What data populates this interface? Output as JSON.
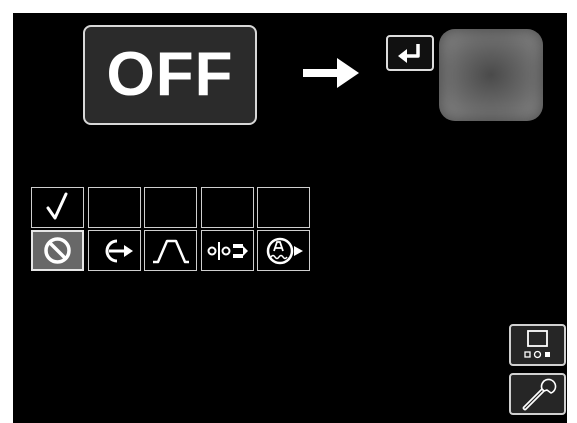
{
  "status": {
    "value": "OFF"
  },
  "icons": {
    "arrow": "right-arrow-icon",
    "enter": "enter-return-icon",
    "check": "checkmark-icon",
    "options": [
      "no-symbol-icon",
      "circle-arrow-icon",
      "trapezoid-pulse-icon",
      "roller-feed-icon",
      "arc-arrow-icon"
    ],
    "display": "display-settings-icon",
    "wrench": "wrench-icon"
  },
  "colors": {
    "background": "#000000",
    "selected_tile": "#686868",
    "preview_tile": "#6c6c6c"
  }
}
